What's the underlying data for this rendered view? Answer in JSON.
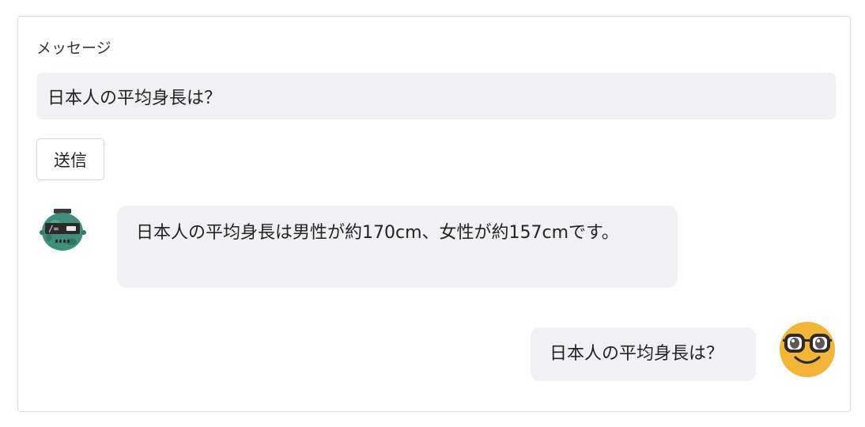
{
  "form": {
    "label": "メッセージ",
    "input_value": "日本人の平均身長は？",
    "send_label": "送信"
  },
  "conversation": {
    "messages": [
      {
        "role": "assistant",
        "avatar_icon": "robot-avatar-icon",
        "text": "日本人の平均身長は男性が約170cm、女性が約157cmです。"
      },
      {
        "role": "user",
        "avatar_icon": "nerd-face-avatar-icon",
        "text": "日本人の平均身長は？"
      }
    ]
  },
  "colors": {
    "bubble_bg": "#f0f1f4",
    "input_bg": "#f0f1f4",
    "border": "#dcdcdf",
    "user_avatar": "#f2b535",
    "bot_avatar": "#3f8f7c"
  }
}
